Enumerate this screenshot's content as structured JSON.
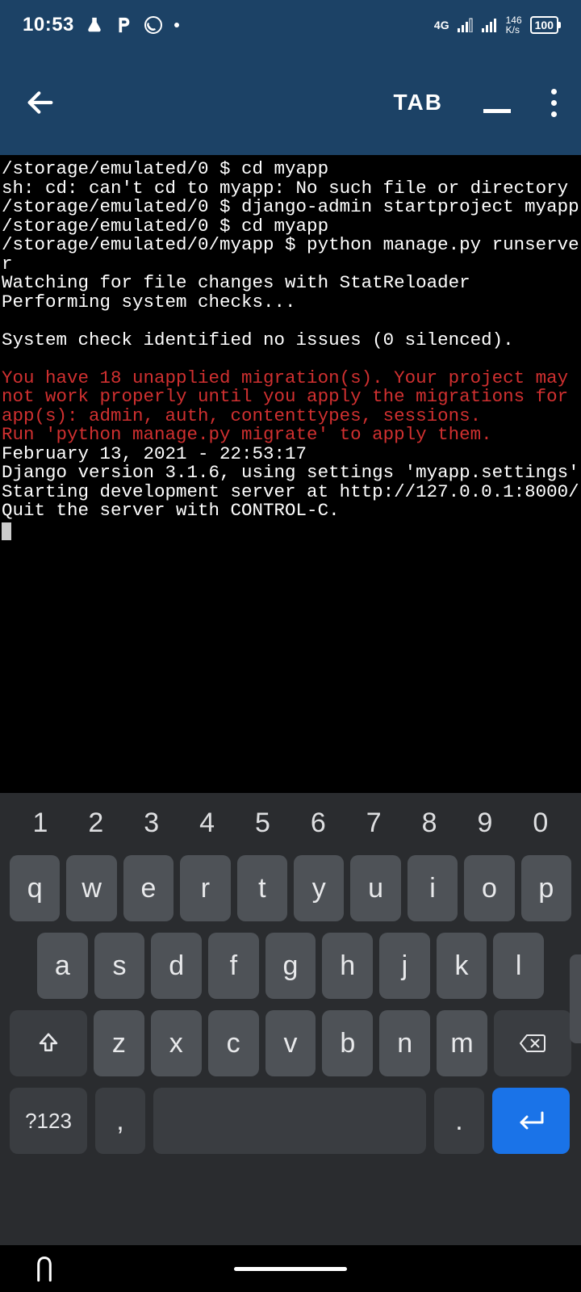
{
  "statusbar": {
    "time": "10:53",
    "network_type": "4G",
    "net_speed_value": "146",
    "net_speed_unit": "K/s",
    "battery": "100"
  },
  "appbar": {
    "tab_label": "TAB"
  },
  "terminal": {
    "lines": [
      {
        "t": "/storage/emulated/0 $ cd myapp",
        "c": "w"
      },
      {
        "t": "sh: cd: can't cd to myapp: No such file or directory",
        "c": "w"
      },
      {
        "t": "/storage/emulated/0 $ django-admin startproject myapp",
        "c": "w"
      },
      {
        "t": "/storage/emulated/0 $ cd myapp",
        "c": "w"
      },
      {
        "t": "/storage/emulated/0/myapp $ python manage.py runserver",
        "c": "w"
      },
      {
        "t": "Watching for file changes with StatReloader",
        "c": "w"
      },
      {
        "t": "Performing system checks...",
        "c": "w"
      },
      {
        "t": "",
        "c": "w"
      },
      {
        "t": "System check identified no issues (0 silenced).",
        "c": "w"
      },
      {
        "t": "",
        "c": "w"
      },
      {
        "t": "You have 18 unapplied migration(s). Your project may not work properly until you apply the migrations for app(s): admin, auth, contenttypes, sessions.",
        "c": "r"
      },
      {
        "t": "Run 'python manage.py migrate' to apply them.",
        "c": "r"
      },
      {
        "t": "February 13, 2021 - 22:53:17",
        "c": "w"
      },
      {
        "t": "Django version 3.1.6, using settings 'myapp.settings'",
        "c": "w"
      },
      {
        "t": "Starting development server at http://127.0.0.1:8000/",
        "c": "w"
      },
      {
        "t": "Quit the server with CONTROL-C.",
        "c": "w"
      }
    ]
  },
  "keyboard": {
    "numbers": [
      "1",
      "2",
      "3",
      "4",
      "5",
      "6",
      "7",
      "8",
      "9",
      "0"
    ],
    "row1": [
      "q",
      "w",
      "e",
      "r",
      "t",
      "y",
      "u",
      "i",
      "o",
      "p"
    ],
    "row2": [
      "a",
      "s",
      "d",
      "f",
      "g",
      "h",
      "j",
      "k",
      "l"
    ],
    "row3": [
      "z",
      "x",
      "c",
      "v",
      "b",
      "n",
      "m"
    ],
    "sym_label": "?123",
    "comma": ",",
    "period": "."
  }
}
